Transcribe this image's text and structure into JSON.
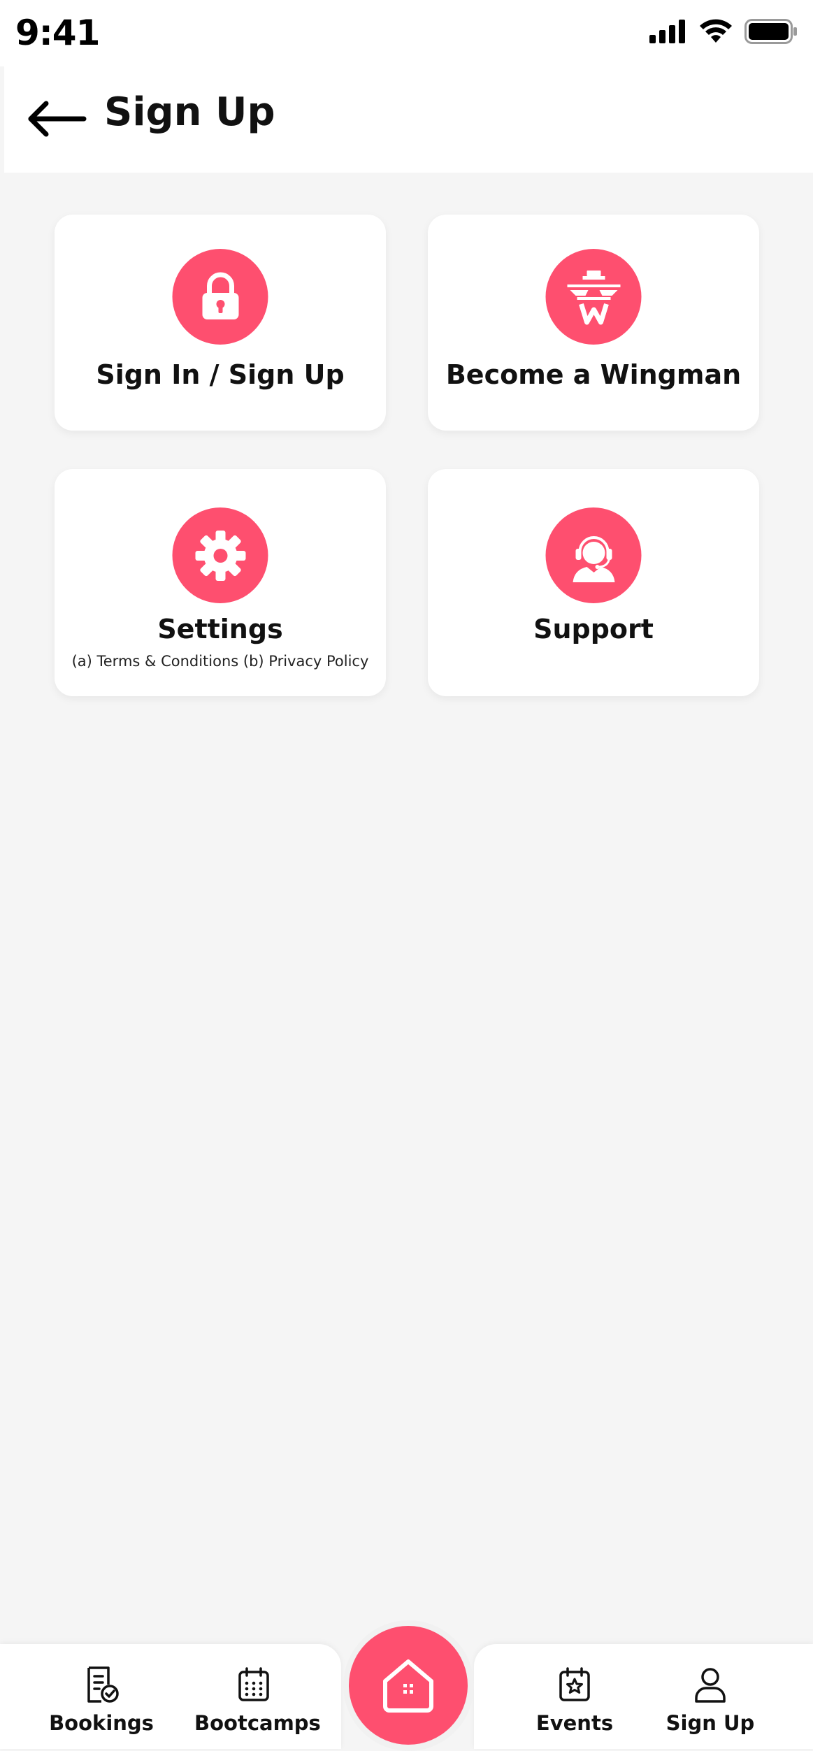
{
  "status_bar": {
    "time": "9:41",
    "icons": [
      "signal-icon",
      "wifi-icon",
      "battery-icon"
    ]
  },
  "header": {
    "title": "Sign Up",
    "back_icon": "arrow-left-icon"
  },
  "cards": [
    {
      "label": "Sign In / Sign Up",
      "icon": "lock-icon"
    },
    {
      "label": "Become a Wingman",
      "icon": "wingman-logo-icon"
    },
    {
      "label": "Settings",
      "sublabel": "(a) Terms & Conditions (b) Privacy Policy",
      "icon": "gear-icon"
    },
    {
      "label": "Support",
      "icon": "headset-agent-icon"
    }
  ],
  "bottom_nav": {
    "items": [
      {
        "label": "Bookings",
        "icon": "bookings-icon"
      },
      {
        "label": "Bootcamps",
        "icon": "calendar-icon"
      },
      {
        "label": "Events",
        "icon": "events-star-icon"
      },
      {
        "label": "Sign Up",
        "icon": "user-icon"
      }
    ],
    "home_icon": "home-icon"
  },
  "colors": {
    "accent": "#fe4f6f",
    "background": "#f5f5f5",
    "card": "#ffffff",
    "text": "#111111"
  }
}
